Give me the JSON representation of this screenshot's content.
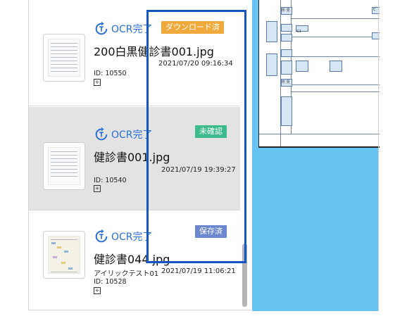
{
  "list": {
    "items": [
      {
        "status": "OCR完了",
        "badge": "ダウンロード済",
        "badge_color": "#f0a93b",
        "filename": "200白黒健診書001.jpg",
        "date": "2021/07/20 09:16:34",
        "subtitle": "",
        "id": "ID: 10550",
        "selected": false
      },
      {
        "status": "OCR完了",
        "badge": "未確認",
        "badge_color": "#3dbb8c",
        "filename": "健診書001.jpg",
        "date": "2021/07/19 19:39:27",
        "subtitle": "",
        "id": "ID: 10540",
        "selected": true
      },
      {
        "status": "OCR完了",
        "badge": "保存済",
        "badge_color": "#6b87cf",
        "filename": "健診書044.jpg",
        "date": "2021/07/19 11:06:21",
        "subtitle": "アイリックテスト01",
        "id": "ID: 10528",
        "selected": false
      }
    ]
  },
  "preview": {
    "labels": [
      "所 見",
      "心電図",
      "胸部写真",
      "負荷時",
      "所 見",
      "腹部超音波",
      "腹部心電",
      "G1",
      "E",
      "その他",
      "C"
    ],
    "accent": "#67c3ef"
  },
  "colors": {
    "highlight_border": "#1455c4",
    "ocr_text": "#2a6fd6"
  }
}
